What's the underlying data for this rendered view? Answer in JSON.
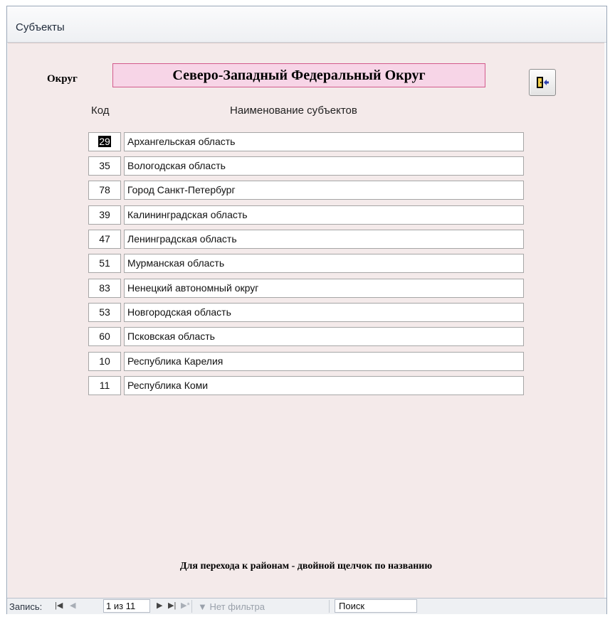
{
  "window": {
    "title": "Субъекты"
  },
  "form": {
    "district_label": "Округ",
    "district_name": "Северо-Западный Федеральный Округ",
    "column_code": "Код",
    "column_name": "Наименование субъектов",
    "rows": [
      {
        "code": "29",
        "name": "Архангельская область"
      },
      {
        "code": "35",
        "name": "Вологодская область"
      },
      {
        "code": "78",
        "name": "Город Санкт-Петербург"
      },
      {
        "code": "39",
        "name": "Калининградская область"
      },
      {
        "code": "47",
        "name": "Ленинградская область"
      },
      {
        "code": "51",
        "name": "Мурманская область"
      },
      {
        "code": "83",
        "name": "Ненецкий автономный округ"
      },
      {
        "code": "53",
        "name": "Новгородская область"
      },
      {
        "code": "60",
        "name": "Псковская область"
      },
      {
        "code": "10",
        "name": "Республика Карелия"
      },
      {
        "code": "11",
        "name": "Республика Коми"
      }
    ],
    "hint": "Для перехода к районам - двойной щелчок по названию",
    "exit_icon": "exit-door-icon"
  },
  "navbar": {
    "record_label": "Запись:",
    "position": "1 из 11",
    "filter_label": "Нет фильтра",
    "search_placeholder": "Поиск"
  }
}
